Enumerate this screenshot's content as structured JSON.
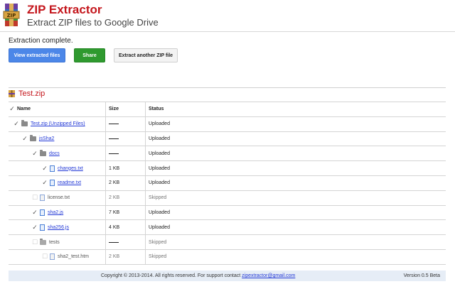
{
  "header": {
    "title": "ZIP Extractor",
    "subtitle": "Extract ZIP files to Google Drive"
  },
  "status": {
    "message": "Extraction complete."
  },
  "buttons": {
    "view": "View extracted files",
    "share": "Share",
    "another": "Extract another ZIP file"
  },
  "zip": {
    "title": "Test.zip"
  },
  "table": {
    "headers": {
      "name": "Name",
      "size": "Size",
      "status": "Status"
    },
    "rows": [
      {
        "name": "Test.zip (Unzipped Files)",
        "size": "",
        "status": "Uploaded"
      },
      {
        "name": "jsSha2",
        "size": "",
        "status": "Uploaded"
      },
      {
        "name": "docs",
        "size": "",
        "status": "Uploaded"
      },
      {
        "name": "changes.txt",
        "size": "1 KB",
        "status": "Uploaded"
      },
      {
        "name": "readme.txt",
        "size": "2 KB",
        "status": "Uploaded"
      },
      {
        "name": "license.txt",
        "size": "2 KB",
        "status": "Skipped"
      },
      {
        "name": "sha2.js",
        "size": "7 KB",
        "status": "Uploaded"
      },
      {
        "name": "sha256.js",
        "size": "4 KB",
        "status": "Uploaded"
      },
      {
        "name": "tests",
        "size": "",
        "status": "Skipped"
      },
      {
        "name": "sha2_test.htm",
        "size": "2 KB",
        "status": "Skipped"
      }
    ]
  },
  "footer": {
    "copyright": "Copyright © 2013-2014. All rights reserved. For support contact ",
    "email": "zipextractor@gmail.com",
    "version": "Version 0.5 Beta"
  },
  "colors": {
    "title_red": "#c4161c",
    "view_blue": "#4c87e8",
    "share_green": "#2f9a2f",
    "link_blue": "#2339d6"
  },
  "icons": [
    "winrar-logo-icon",
    "zip-icon",
    "checkbox-icon",
    "folder-icon",
    "file-icon"
  ]
}
